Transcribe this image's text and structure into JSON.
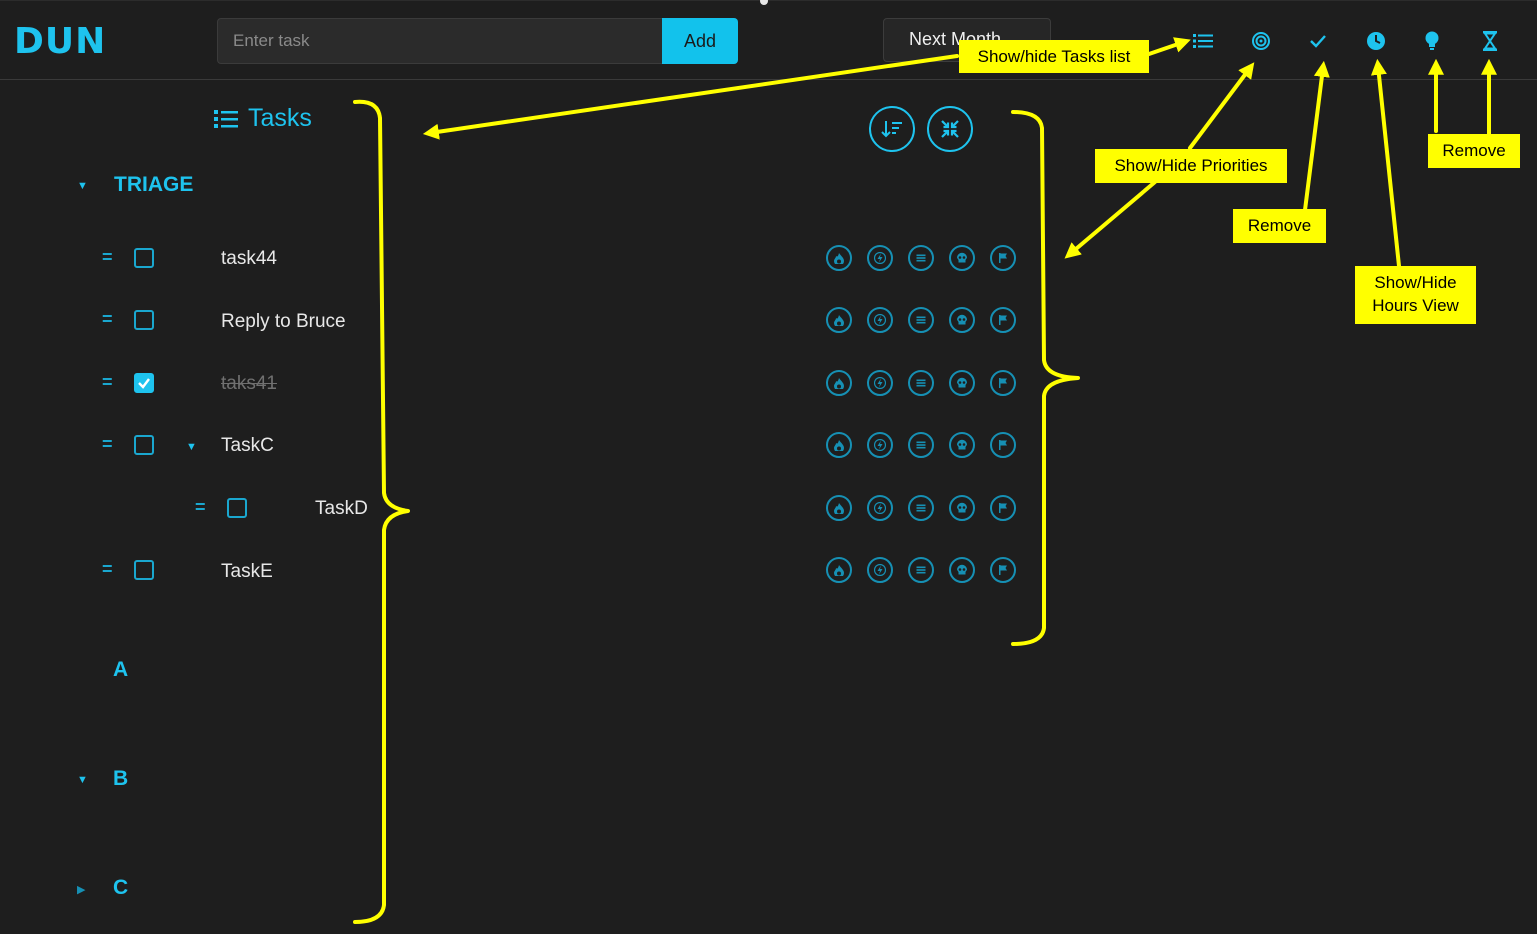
{
  "app": {
    "brand": "DUN"
  },
  "header": {
    "input_placeholder": "Enter task",
    "add_label": "Add",
    "month_select": "Next Month"
  },
  "top_icons": [
    "list-icon",
    "target-icon",
    "check-icon",
    "clock-icon",
    "bulb-icon",
    "hourglass-icon"
  ],
  "tasks_panel": {
    "heading": "Tasks",
    "sections": [
      {
        "title": "TRIAGE",
        "state": "expanded"
      },
      {
        "title": "A",
        "state": "none"
      },
      {
        "title": "B",
        "state": "expanded"
      },
      {
        "title": "C",
        "state": "collapsed"
      }
    ],
    "tasks": [
      {
        "name": "task44",
        "done": false,
        "level": 0
      },
      {
        "name": "Reply to Bruce",
        "done": false,
        "level": 0
      },
      {
        "name": "taks41",
        "done": true,
        "level": 0
      },
      {
        "name": "TaskC",
        "done": false,
        "level": 0,
        "has_children": true
      },
      {
        "name": "TaskD",
        "done": false,
        "level": 1
      },
      {
        "name": "TaskE",
        "done": false,
        "level": 0
      }
    ]
  },
  "priority_icons": [
    "fire-icon",
    "bolt-icon",
    "lines-icon",
    "skull-icon",
    "flag-icon"
  ],
  "toolbar_icons": [
    "sort-icon",
    "collapse-icon"
  ],
  "annotations": {
    "show_hide_tasks": "Show/hide Tasks list",
    "show_hide_priorities": "Show/Hide Priorities",
    "remove_1": "Remove",
    "show_hide_hours_line1": "Show/Hide",
    "show_hide_hours_line2": "Hours View",
    "remove_2": "Remove"
  },
  "colors": {
    "accent": "#1ec3ee",
    "background": "#1e1e1e",
    "callout": "#ffff00"
  }
}
